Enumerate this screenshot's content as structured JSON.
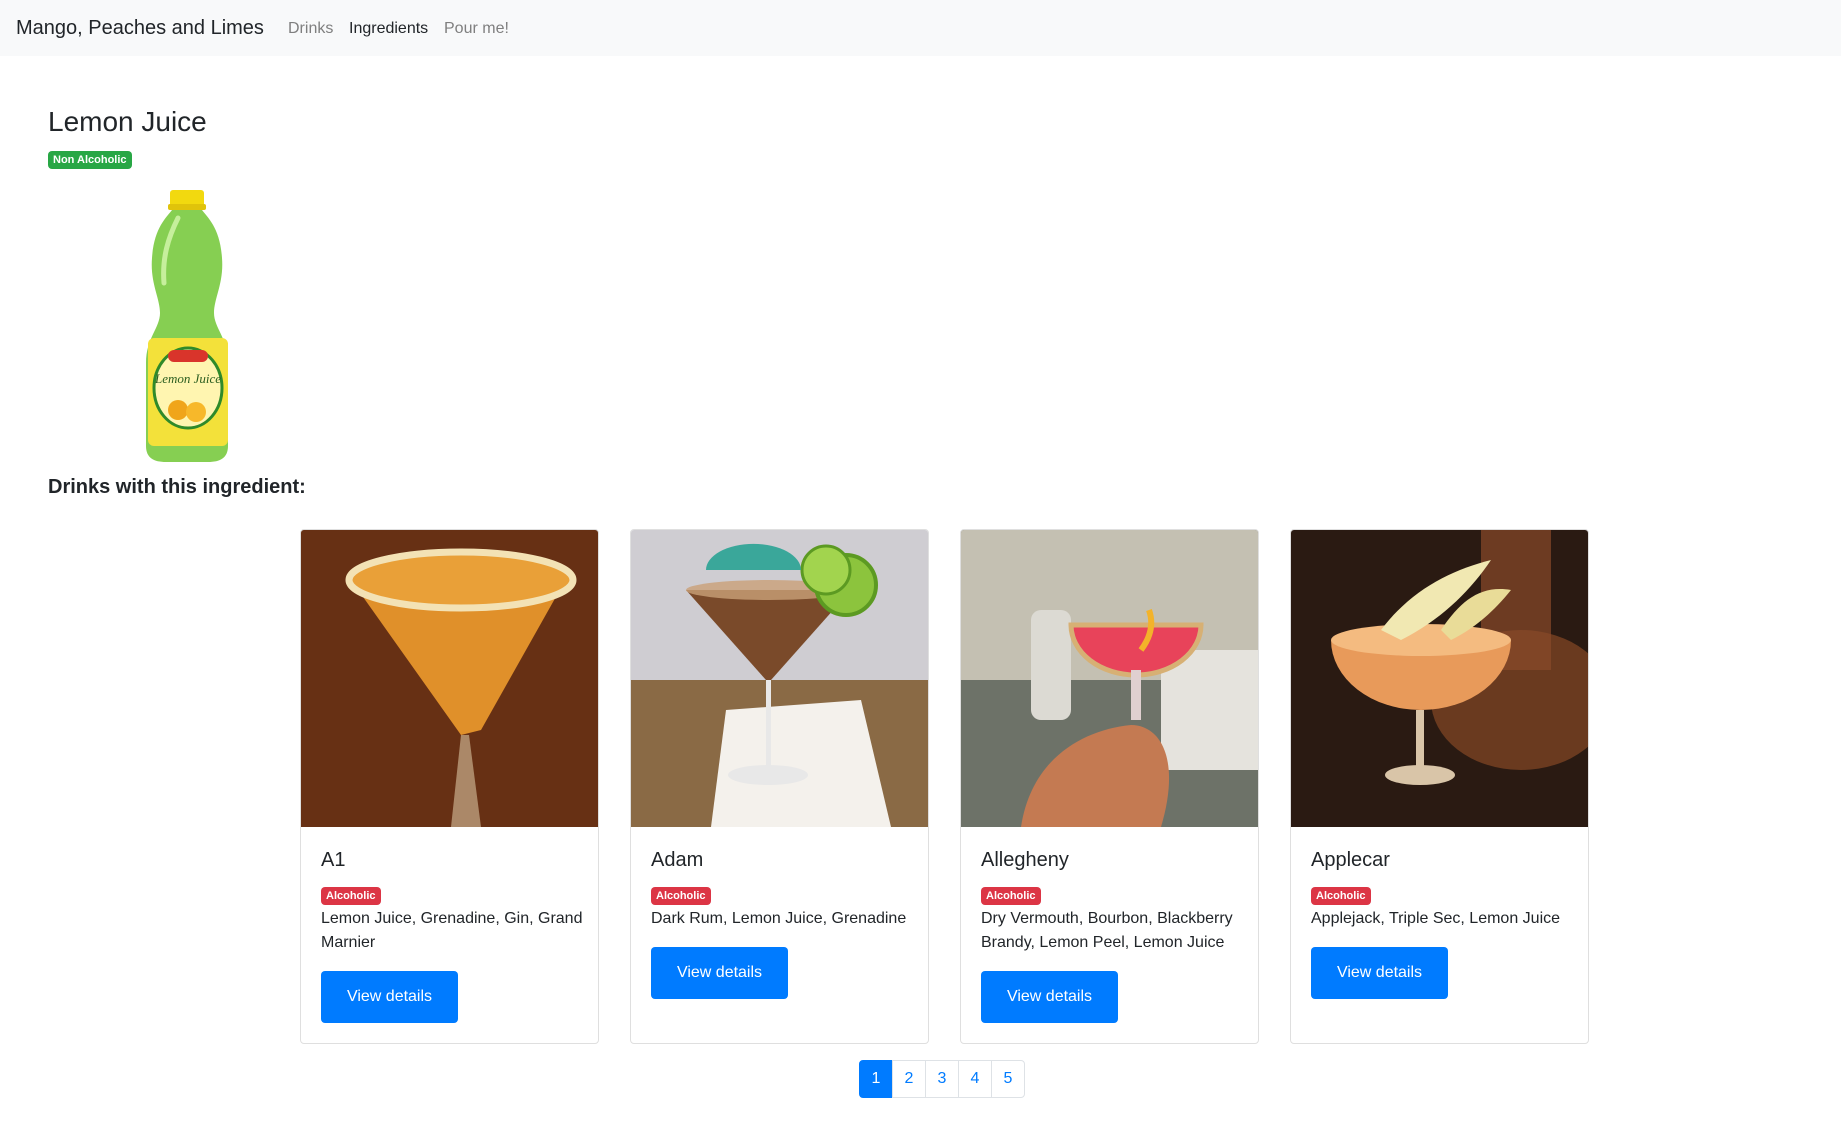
{
  "navbar": {
    "brand": "Mango, Peaches and Limes",
    "links": [
      {
        "label": "Drinks",
        "active": false
      },
      {
        "label": "Ingredients",
        "active": true
      },
      {
        "label": "Pour me!",
        "active": false
      }
    ]
  },
  "ingredient": {
    "name": "Lemon Juice",
    "badge": "Non Alcoholic",
    "image_icon": "lemon-juice-bottle-image",
    "label_text": "Lemon Juice"
  },
  "drinks_heading": "Drinks with this ingredient:",
  "drinks": [
    {
      "name": "A1",
      "badge": "Alcoholic",
      "ingredients": "Lemon Juice, Grenadine, Gin, Grand Marnier",
      "button": "View details"
    },
    {
      "name": "Adam",
      "badge": "Alcoholic",
      "ingredients": "Dark Rum, Lemon Juice, Grenadine",
      "button": "View details"
    },
    {
      "name": "Allegheny",
      "badge": "Alcoholic",
      "ingredients": "Dry Vermouth, Bourbon, Blackberry Brandy, Lemon Peel, Lemon Juice",
      "button": "View details"
    },
    {
      "name": "Applecar",
      "badge": "Alcoholic",
      "ingredients": "Applejack, Triple Sec, Lemon Juice",
      "button": "View details"
    }
  ],
  "pagination": {
    "pages": [
      "1",
      "2",
      "3",
      "4",
      "5"
    ],
    "current": "1"
  },
  "colors": {
    "primary": "#007bff",
    "success": "#28a745",
    "danger": "#dc3545",
    "navbar_bg": "#f8f9fa"
  }
}
